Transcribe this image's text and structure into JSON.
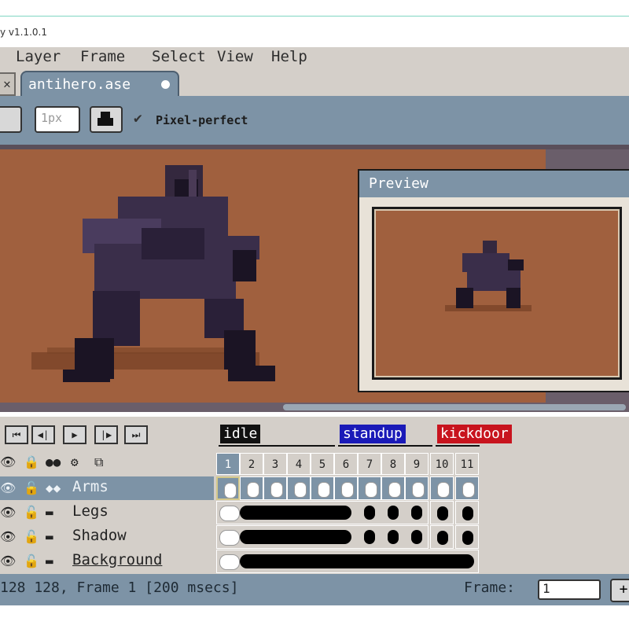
{
  "window": {
    "title": "y v1.1.0.1"
  },
  "menu": [
    {
      "label": "Layer",
      "u": "L"
    },
    {
      "label": "Frame",
      "u": "r"
    },
    {
      "label": "Select",
      "u": "S"
    },
    {
      "label": "View",
      "u": "V"
    },
    {
      "label": "Help",
      "u": "H"
    }
  ],
  "tabs": {
    "close_glyph": "✕",
    "active_label": "antihero.ase"
  },
  "toolbar": {
    "size_value": "1px",
    "pixel_perfect_label": "Pixel-perfect"
  },
  "preview": {
    "title": "Preview"
  },
  "timeline": {
    "play_buttons": [
      "⏮",
      "◀|",
      "▶",
      "|▶",
      "⏭"
    ],
    "tags": [
      {
        "label": "idle",
        "color": "#111111"
      },
      {
        "label": "standup",
        "color": "#1a1ab8"
      },
      {
        "label": "kickdoor",
        "color": "#c8141e"
      }
    ],
    "frames": [
      "1",
      "2",
      "3",
      "4",
      "5",
      "6",
      "7",
      "8",
      "9",
      "10",
      "11"
    ],
    "layers": [
      {
        "name": "Arms"
      },
      {
        "name": "Legs"
      },
      {
        "name": "Shadow"
      },
      {
        "name": "Background"
      }
    ]
  },
  "status": {
    "text": "128 128, Frame 1 [200 msecs]",
    "frame_label": "Frame:",
    "frame_value": "1",
    "plus_label": "+"
  },
  "colors": {
    "accent": "#7d93a6",
    "canvas_bg": "#a0603e",
    "panel": "#d4cfc9"
  }
}
